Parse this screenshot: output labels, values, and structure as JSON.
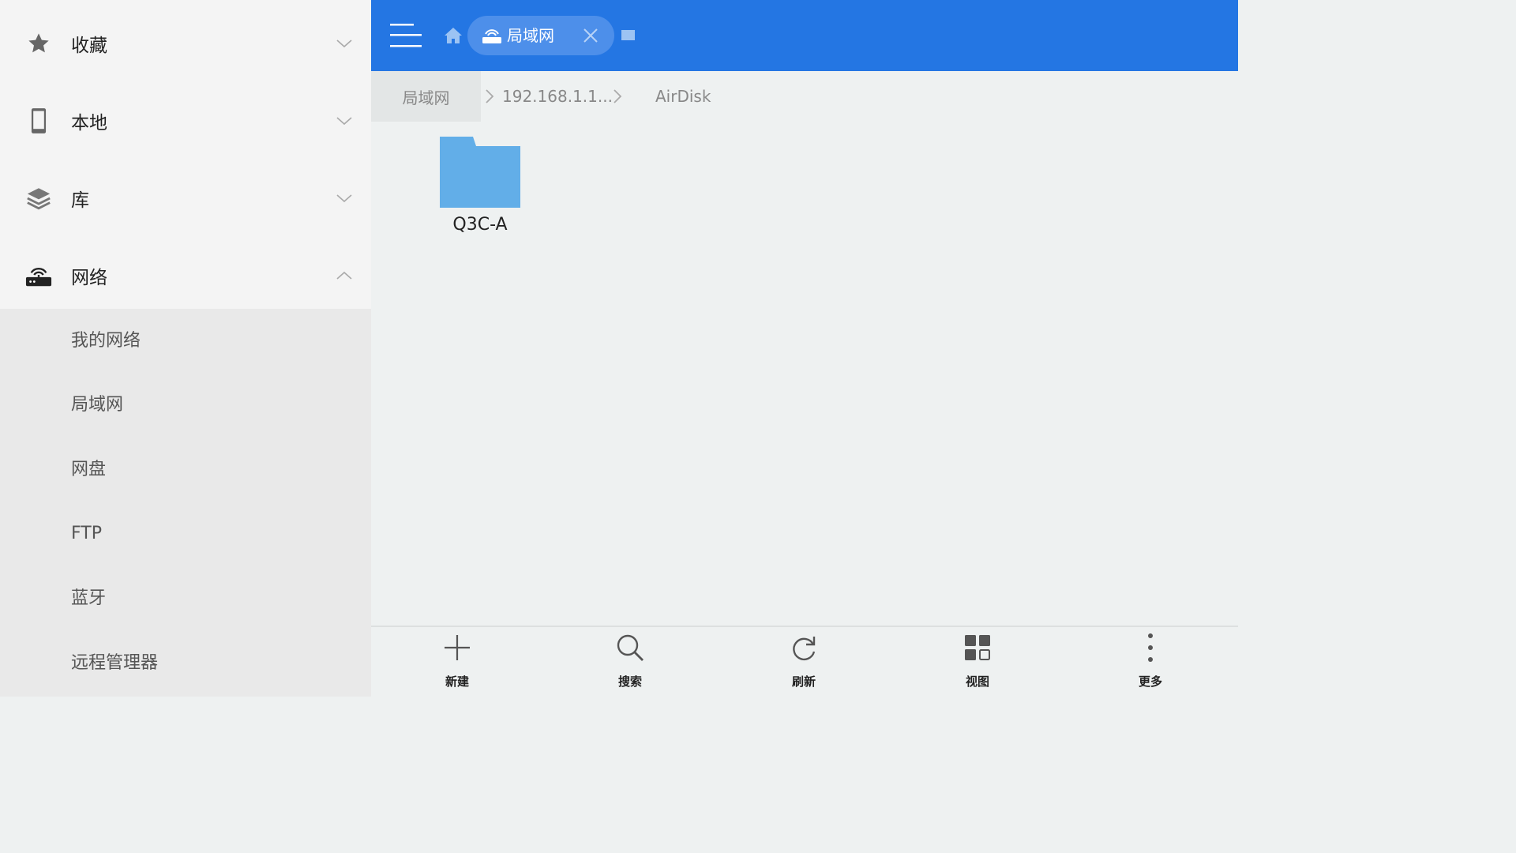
{
  "sidebar": {
    "sections": [
      {
        "label": "收藏",
        "icon": "star-icon",
        "expanded": false
      },
      {
        "label": "本地",
        "icon": "phone-icon",
        "expanded": false
      },
      {
        "label": "库",
        "icon": "layers-icon",
        "expanded": false
      },
      {
        "label": "网络",
        "icon": "router-icon",
        "expanded": true
      }
    ],
    "network_items": [
      "我的网络",
      "局域网",
      "网盘",
      "FTP",
      "蓝牙",
      "远程管理器"
    ]
  },
  "topbar": {
    "tab_label": "局域网",
    "accent": "#2476e3",
    "tab_bg": "#4d8fea"
  },
  "breadcrumb": [
    "局域网",
    "192.168.1.1...",
    "AirDisk"
  ],
  "files": [
    {
      "name": "Q3C-A",
      "type": "folder",
      "color": "#62aee8"
    }
  ],
  "toolbar": {
    "new_label": "新建",
    "search_label": "搜索",
    "refresh_label": "刷新",
    "view_label": "视图",
    "more_label": "更多"
  }
}
